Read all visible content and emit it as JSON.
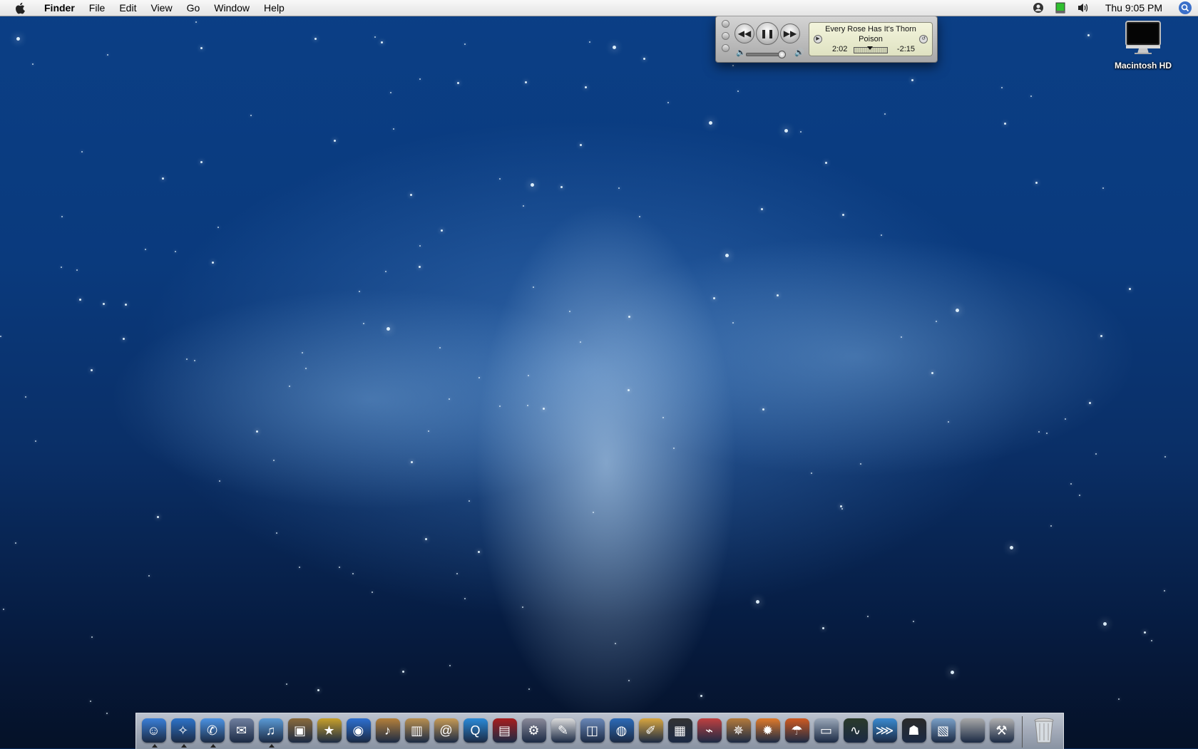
{
  "menubar": {
    "apple_icon": "apple-logo-icon",
    "app_name": "Finder",
    "menus": [
      "File",
      "Edit",
      "View",
      "Go",
      "Window",
      "Help"
    ],
    "status_icons": [
      "account-icon",
      "battery-icon",
      "volume-icon"
    ],
    "clock": "Thu 9:05 PM",
    "spotlight_icon": "spotlight-search-icon"
  },
  "mini_player": {
    "track_title": "Every Rose Has It's Thorn",
    "artist": "Poison",
    "elapsed": "2:02",
    "remaining": "-2:15",
    "progress_fraction": 0.48,
    "volume_fraction": 1.0,
    "controls": [
      "rewind-icon",
      "pause-icon",
      "fast-forward-icon"
    ]
  },
  "desktop_icons": [
    {
      "label": "Macintosh HD",
      "icon": "imac-drive-icon"
    }
  ],
  "dock": {
    "apps": [
      {
        "icon": "finder-icon",
        "running": true,
        "color": "#3a7fd8"
      },
      {
        "icon": "safari-icon",
        "running": true,
        "color": "#2d73c9"
      },
      {
        "icon": "ichat-icon",
        "running": true,
        "color": "#4c93e4"
      },
      {
        "icon": "mail-icon",
        "running": false,
        "color": "#6f7f9f"
      },
      {
        "icon": "itunes-icon",
        "running": true,
        "color": "#5a9ad6"
      },
      {
        "icon": "iphoto-icon",
        "running": false,
        "color": "#8a6a3a"
      },
      {
        "icon": "imovie-star-icon",
        "running": false,
        "color": "#c8a02a"
      },
      {
        "icon": "dvd-player-icon",
        "running": false,
        "color": "#2d6fd0"
      },
      {
        "icon": "garageband-icon",
        "running": false,
        "color": "#b5803a"
      },
      {
        "icon": "keynote-icon",
        "running": false,
        "color": "#b98f4f"
      },
      {
        "icon": "address-book-icon",
        "running": false,
        "color": "#c79a55"
      },
      {
        "icon": "quicktime-icon",
        "running": false,
        "color": "#2a8ad8"
      },
      {
        "icon": "photo-booth-icon",
        "running": false,
        "color": "#a81e1e"
      },
      {
        "icon": "automator-icon",
        "running": false,
        "color": "#8a8a9a"
      },
      {
        "icon": "textedit-icon",
        "running": false,
        "color": "#dcdcdc"
      },
      {
        "icon": "preview-icon",
        "running": false,
        "color": "#6a88b8"
      },
      {
        "icon": "google-earth-icon",
        "running": false,
        "color": "#2c6bb8"
      },
      {
        "icon": "pages-icon",
        "running": false,
        "color": "#d9a640"
      },
      {
        "icon": "film-clapper-icon",
        "running": false,
        "color": "#333333"
      },
      {
        "icon": "hair-dryer-icon",
        "running": false,
        "color": "#c04040"
      },
      {
        "icon": "ship-wheel-icon",
        "running": false,
        "color": "#b57a3a"
      },
      {
        "icon": "fish-cog-icon",
        "running": false,
        "color": "#e07a2a"
      },
      {
        "icon": "umbrella-icon",
        "running": false,
        "color": "#d05a20"
      },
      {
        "icon": "classic-mac-icon",
        "running": false,
        "color": "#9aa7b8"
      },
      {
        "icon": "activity-monitor-icon",
        "running": false,
        "color": "#2a3a2a"
      },
      {
        "icon": "fish-icon",
        "running": false,
        "color": "#3a8ad0"
      },
      {
        "icon": "cat-icon",
        "running": false,
        "color": "#2a2a2a"
      },
      {
        "icon": "software-update-icon",
        "running": false,
        "color": "#7aa0c8"
      },
      {
        "icon": "system-preferences-icon",
        "running": false,
        "color": "#a8a8a8"
      },
      {
        "icon": "utility-tool-icon",
        "running": false,
        "color": "#b0b0b0"
      }
    ],
    "trash_icon": "trash-icon"
  }
}
